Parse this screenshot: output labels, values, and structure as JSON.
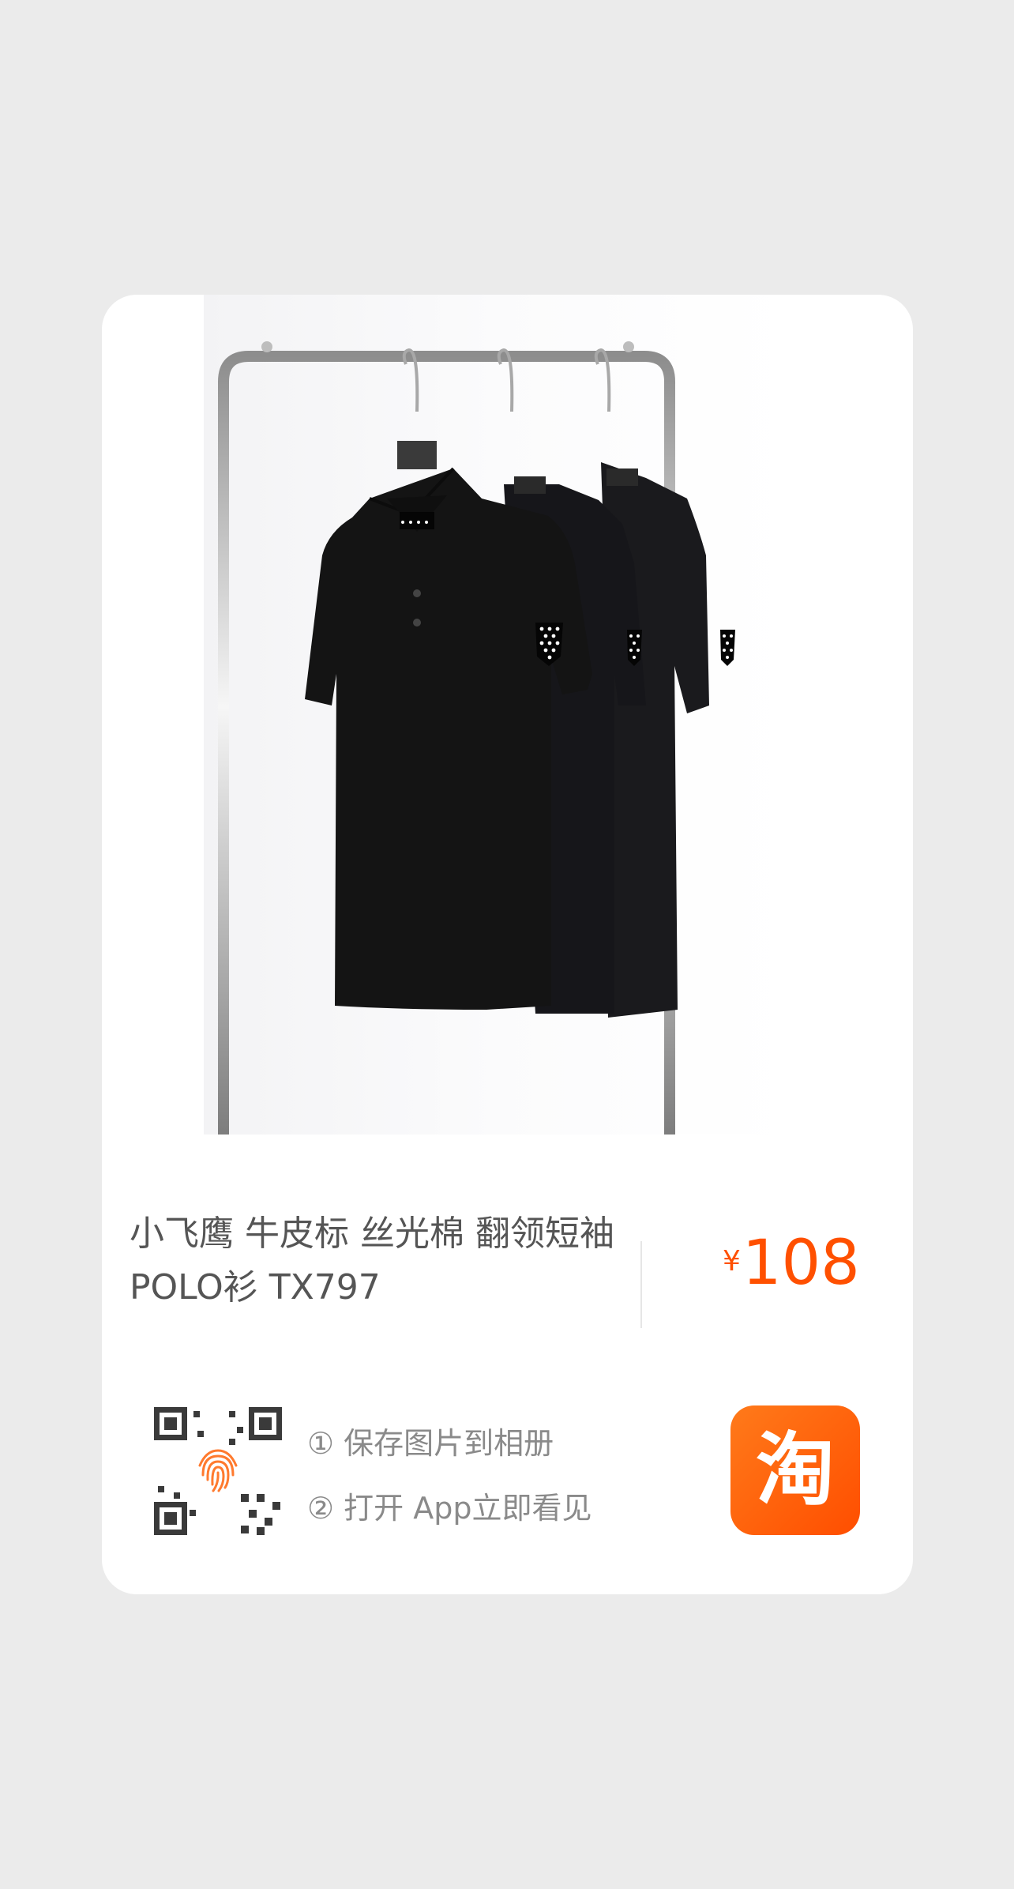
{
  "product": {
    "title": "小飞鹰 牛皮标 丝光棉 翻领短袖 POLO衫 TX797",
    "currency_symbol": "¥",
    "price": "108"
  },
  "instructions": {
    "step1": "① 保存图片到相册",
    "step2": "② 打开 App立即看见"
  },
  "app": {
    "logo_text": "淘",
    "logo_color": "#ff5000"
  },
  "colors": {
    "page_bg": "#ebebeb",
    "card_bg": "#ffffff",
    "price": "#ff5000",
    "shirt": "#141414"
  }
}
